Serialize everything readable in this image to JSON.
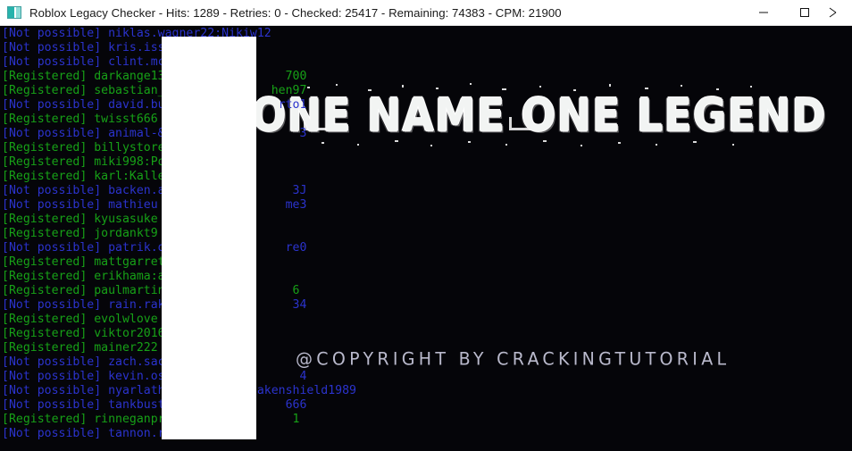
{
  "window": {
    "title": "Roblox Legacy Checker - Hits: 1289 - Retries: 0 - Checked: 25417 - Remaining: 74383 - CPM: 21900",
    "app_name": "Roblox Legacy Checker",
    "stats": {
      "hits_label": "Hits",
      "hits": "1289",
      "retries_label": "Retries",
      "retries": "0",
      "checked_label": "Checked",
      "checked": "25417",
      "remaining_label": "Remaining",
      "remaining": "74383",
      "cpm_label": "CPM",
      "cpm": "21900"
    },
    "controls": {
      "minimize": "Minimize",
      "maximize": "Maximize",
      "close": "Close"
    },
    "icon": "app-window-icon"
  },
  "background": {
    "logo": "ONE NAME ONE LEGEND",
    "copyright": "@COPYRIGHT BY CRACKINGTUTORIAL"
  },
  "colors": {
    "registered": "#17a117",
    "not_possible": "#2b33cd",
    "console_background": "#050509",
    "titlebar_background": "#ffffff",
    "redaction": "#ffffff"
  },
  "console": {
    "status_registered": "[Registered]",
    "status_not_possible": "[Not possible]",
    "lines": [
      {
        "status": "not",
        "text": "[Not possible] niklas.wagner22:Nikiw12"
      },
      {
        "status": "not",
        "text": "[Not possible] kris.iss"
      },
      {
        "status": "not",
        "text": "[Not possible] clint.mc"
      },
      {
        "status": "reg",
        "text": "[Registered] darkange13                 700"
      },
      {
        "status": "reg",
        "text": "[Registered] sebastian_               hen97"
      },
      {
        "status": "not",
        "text": "[Not possible] david.bu                rto1"
      },
      {
        "status": "reg",
        "text": "[Registered] twisst666"
      },
      {
        "status": "not",
        "text": "[Not possible] animal-&                   3"
      },
      {
        "status": "reg",
        "text": "[Registered] billystore"
      },
      {
        "status": "reg",
        "text": "[Registered] miki998:Po"
      },
      {
        "status": "reg",
        "text": "[Registered] karl:Kalle"
      },
      {
        "status": "not",
        "text": "[Not possible] backen.a                  3J"
      },
      {
        "status": "not",
        "text": "[Not possible] mathieu                  me3"
      },
      {
        "status": "reg",
        "text": "[Registered] kyusasuke"
      },
      {
        "status": "reg",
        "text": "[Registered] jordankt9"
      },
      {
        "status": "not",
        "text": "[Not possible] patrik.o                 re0"
      },
      {
        "status": "reg",
        "text": "[Registered] mattgarret"
      },
      {
        "status": "reg",
        "text": "[Registered] erikhama:a"
      },
      {
        "status": "reg",
        "text": "[Registered] paulmartin                  6"
      },
      {
        "status": "not",
        "text": "[Not possible] rain.rak                  34"
      },
      {
        "status": "reg",
        "text": "[Registered] evolwlove"
      },
      {
        "status": "reg",
        "text": "[Registered] viktor2016"
      },
      {
        "status": "reg",
        "text": "[Registered] mainer222"
      },
      {
        "status": "not",
        "text": "[Not possible] zach.sac"
      },
      {
        "status": "not",
        "text": "[Not possible] kevin.os                   4"
      },
      {
        "status": "not",
        "text": "[Not possible] nyarlath             akenshield1989"
      },
      {
        "status": "not",
        "text": "[Not possible] tankbust                 666"
      },
      {
        "status": "reg",
        "text": "[Registered] rinneganpr                  1"
      },
      {
        "status": "not",
        "text": "[Not possible] tannon.r"
      }
    ]
  },
  "redaction": {
    "label": "redacted-region"
  }
}
